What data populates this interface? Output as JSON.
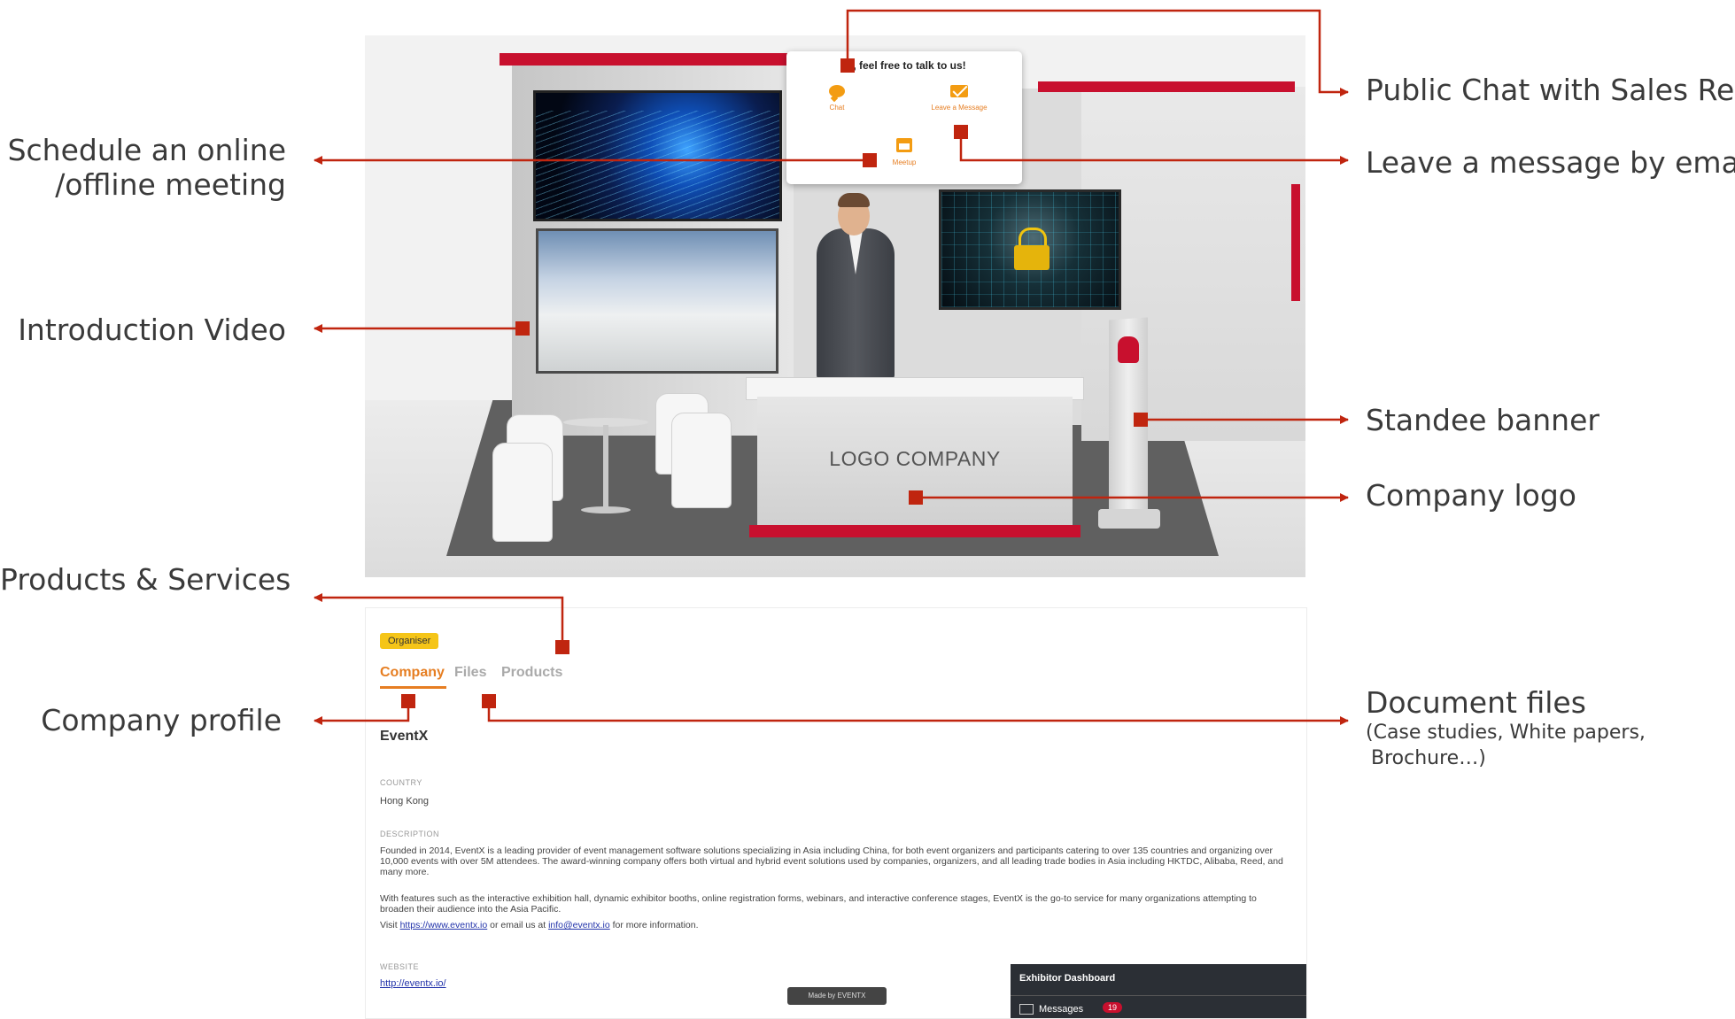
{
  "callouts": {
    "public_chat": "Public Chat with Sales Rep",
    "leave_message": "Leave a message by email",
    "schedule_line1": "Schedule an online",
    "schedule_line2": "/offline meeting",
    "intro_video": "Introduction Video",
    "standee_banner": "Standee banner",
    "company_logo": "Company logo",
    "products_services": "Products & Services",
    "company_profile": "Company profile",
    "document_files": "Document files",
    "document_files_sub1": "(Case studies, White papers,",
    "document_files_sub2": "Brochure…)"
  },
  "booth": {
    "desk_logo": "LOGO COMPANY",
    "popup": {
      "title": "Hi, feel free to talk to us!",
      "chat_label": "Chat",
      "message_label": "Leave a Message",
      "meetup_label": "Meetup"
    }
  },
  "panel": {
    "badge": "Organiser",
    "tabs": [
      "Company",
      "Files",
      "Products"
    ],
    "company_name": "EventX",
    "country_label": "COUNTRY",
    "country_value": "Hong Kong",
    "description_label": "DESCRIPTION",
    "description_p1": "Founded in 2014, EventX is a leading provider of event management software solutions specializing in Asia including China, for both event organizers and participants catering to over 135 countries and organizing over 10,000 events with over 5M attendees. The award-winning company offers both virtual and hybrid event solutions used by companies, organizers, and all leading trade bodies in Asia including HKTDC, Alibaba, Reed, and many more.",
    "description_p2": "With features such as the interactive exhibition hall, dynamic exhibitor booths, online registration forms, webinars, and interactive conference stages, EventX is the go-to service for many organizations attempting to broaden their audience into the Asia Pacific.",
    "visit_prefix": "Visit ",
    "visit_link": "https://www.eventx.io",
    "visit_middle": " or email us at ",
    "visit_email": "info@eventx.io",
    "visit_suffix": " for more information.",
    "website_label": "WEBSITE",
    "website_value": "http://eventx.io/",
    "made_by": "Made by  EVENTX",
    "dashboard_title": "Exhibitor Dashboard",
    "messages_label": "Messages",
    "messages_count": "19"
  },
  "colors": {
    "callout_line": "#c0250f",
    "accent_orange": "#e67e22",
    "booth_red": "#c8102e"
  }
}
